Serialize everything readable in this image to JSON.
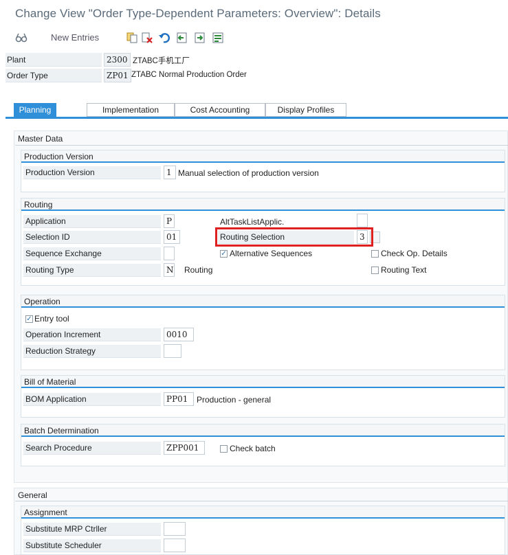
{
  "window": {
    "title": "Change View \"Order Type-Dependent Parameters: Overview\": Details"
  },
  "toolbar": {
    "new_entries_label": "New Entries",
    "icons": [
      "glasses-display-change-icon",
      "copy-icon",
      "delete-icon",
      "undo-icon",
      "previous-entry-icon",
      "next-entry-icon",
      "select-all-icon"
    ]
  },
  "header": {
    "plant_label": "Plant",
    "plant_code": "2300",
    "plant_desc": "ZTABC手机工厂",
    "order_type_label": "Order Type",
    "order_type_code": "ZP01",
    "order_type_desc": "ZTABC Normal Production Order"
  },
  "tabs": [
    {
      "label": "Planning",
      "active": true
    },
    {
      "label": "Implementation",
      "active": false
    },
    {
      "label": "Cost Accounting",
      "active": false
    },
    {
      "label": "Display Profiles",
      "active": false
    }
  ],
  "master_data": {
    "title": "Master Data",
    "production_version": {
      "title": "Production Version",
      "label": "Production Version",
      "value": "1",
      "desc": "Manual selection of production version"
    },
    "routing": {
      "title": "Routing",
      "application_label": "Application",
      "application_value": "P",
      "alt_task_list_label": "AltTaskListApplic.",
      "alt_task_list_value": "",
      "selection_id_label": "Selection ID",
      "selection_id_value": "01",
      "routing_selection_label": "Routing Selection",
      "routing_selection_value": "3",
      "sequence_exchange_label": "Sequence Exchange",
      "sequence_exchange_value": "",
      "alt_sequences_label": "Alternative Sequences",
      "alt_sequences_checked": true,
      "check_op_details_label": "Check Op. Details",
      "check_op_details_checked": false,
      "routing_type_label": "Routing Type",
      "routing_type_value": "N",
      "routing_type_desc": "Routing",
      "routing_text_label": "Routing Text",
      "routing_text_checked": false
    },
    "operation": {
      "title": "Operation",
      "entry_tool_label": "Entry tool",
      "entry_tool_checked": true,
      "increment_label": "Operation Increment",
      "increment_value": "0010",
      "reduction_label": "Reduction Strategy",
      "reduction_value": ""
    },
    "bom": {
      "title": "Bill of Material",
      "label": "BOM Application",
      "value": "PP01",
      "desc": "Production - general"
    },
    "batch": {
      "title": "Batch Determination",
      "label": "Search Procedure",
      "value": "ZPP001",
      "check_batch_label": "Check batch",
      "check_batch_checked": false
    }
  },
  "general": {
    "title": "General",
    "assignment": {
      "title": "Assignment",
      "mrp_label": "Substitute MRP Ctrller",
      "mrp_value": "",
      "scheduler_label": "Substitute Scheduler",
      "scheduler_value": ""
    }
  },
  "colors": {
    "accent": "#2f8fd8",
    "highlight": "#e02020"
  }
}
